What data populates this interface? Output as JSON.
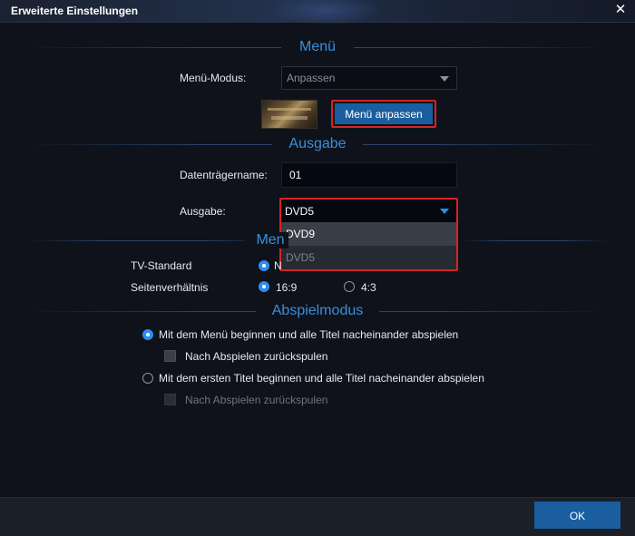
{
  "window": {
    "title": "Erweiterte Einstellungen",
    "close_icon": "close-icon"
  },
  "menu_section": {
    "title": "Menü",
    "mode_label": "Menü-Modus:",
    "mode_value": "Anpassen",
    "customize_button": "Menü anpassen"
  },
  "output_section": {
    "title": "Ausgabe",
    "disc_name_label": "Datenträgername:",
    "disc_name_value": "01",
    "output_label": "Ausgabe:",
    "output_value": "DVD5",
    "output_options": [
      "DVD9",
      "DVD5"
    ]
  },
  "media_section": {
    "title_partial": "Men",
    "tv_standard_label": "TV-Standard",
    "tv_standard_value_partial": "N",
    "aspect_label": "Seitenverhältnis",
    "aspect_options": [
      "16:9",
      "4:3"
    ],
    "aspect_selected": "16:9"
  },
  "playback_section": {
    "title": "Abspielmodus",
    "option1": "Mit dem Menü beginnen und alle Titel nacheinander abspielen",
    "option1_checkbox": "Nach Abspielen zurückspulen",
    "option2": "Mit dem ersten Titel beginnen und alle Titel nacheinander abspielen",
    "option2_checkbox": "Nach Abspielen zurückspulen",
    "selected": "option1"
  },
  "footer": {
    "ok_label": "OK"
  },
  "colors": {
    "accent": "#2d8cf0",
    "highlight": "#d42424",
    "button": "#1a5ea0"
  }
}
